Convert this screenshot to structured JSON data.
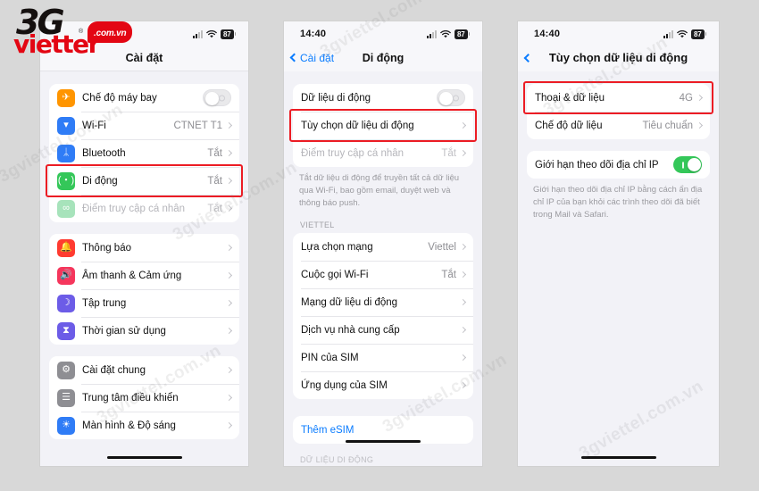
{
  "brand": {
    "logo_main": "3G",
    "logo_sub": "viettel",
    "logo_bubble": ".com.vn",
    "logo_tm": "®",
    "watermark": "3gviettel.com.vn",
    "accent_red": "#ec1c24",
    "brand_red": "#e30613",
    "ios_blue": "#0a7cff",
    "ios_green": "#34c759"
  },
  "status_bar": {
    "time_phone1": "",
    "time_phone2": "14:40",
    "time_phone3": "14:40",
    "battery": "87",
    "signal_icon": "cellular-signal-icon",
    "wifi_icon": "wifi-icon",
    "battery_icon": "battery-icon"
  },
  "phone1": {
    "nav": {
      "title": "Cài đặt",
      "back_label": ""
    },
    "groups": [
      {
        "rows": [
          {
            "icon": "airplane-icon",
            "icon_color": "#ff9500",
            "glyph": "✈",
            "label": "Chế độ máy bay",
            "value": "",
            "control": "toggle-off",
            "dim": false,
            "highlight": false
          },
          {
            "icon": "wifi-icon",
            "icon_color": "#2f7cf6",
            "glyph": "▾",
            "label": "Wi-Fi",
            "value": "CTNET T1",
            "control": "chevron",
            "dim": false,
            "highlight": false
          },
          {
            "icon": "bluetooth-icon",
            "icon_color": "#2f7cf6",
            "glyph": "ᛦ",
            "label": "Bluetooth",
            "value": "Tắt",
            "control": "chevron",
            "dim": false,
            "highlight": false
          },
          {
            "icon": "cellular-icon",
            "icon_color": "#34c759",
            "glyph": "(・)",
            "label": "Di động",
            "value": "Tắt",
            "control": "chevron",
            "dim": false,
            "highlight": true
          },
          {
            "icon": "hotspot-icon",
            "icon_color": "#a7e3bb",
            "glyph": "∞",
            "label": "Điểm truy cập cá nhân",
            "value": "Tắt",
            "control": "chevron",
            "dim": true,
            "highlight": false
          }
        ]
      },
      {
        "rows": [
          {
            "icon": "notifications-icon",
            "icon_color": "#ff3b30",
            "glyph": "🔔",
            "label": "Thông báo",
            "value": "",
            "control": "chevron",
            "dim": false,
            "highlight": false
          },
          {
            "icon": "sound-icon",
            "icon_color": "#f5365c",
            "glyph": "🔊",
            "label": "Âm thanh & Cảm ứng",
            "value": "",
            "control": "chevron",
            "dim": false,
            "highlight": false
          },
          {
            "icon": "focus-moon-icon",
            "icon_color": "#6c5ce7",
            "glyph": "☽",
            "label": "Tập trung",
            "value": "",
            "control": "chevron",
            "dim": false,
            "highlight": false
          },
          {
            "icon": "screen-time-icon",
            "icon_color": "#6c5ce7",
            "glyph": "⧗",
            "label": "Thời gian sử dụng",
            "value": "",
            "control": "chevron",
            "dim": false,
            "highlight": false
          }
        ]
      },
      {
        "rows": [
          {
            "icon": "general-gear-icon",
            "icon_color": "#8e8e93",
            "glyph": "⚙",
            "label": "Cài đặt chung",
            "value": "",
            "control": "chevron",
            "dim": false,
            "highlight": false
          },
          {
            "icon": "control-center-icon",
            "icon_color": "#8e8e93",
            "glyph": "☰",
            "label": "Trung tâm điều khiển",
            "value": "",
            "control": "chevron",
            "dim": false,
            "highlight": false
          },
          {
            "icon": "brightness-icon",
            "icon_color": "#2f7cf6",
            "glyph": "☀",
            "label": "Màn hình & Độ sáng",
            "value": "",
            "control": "chevron",
            "dim": false,
            "highlight": false
          }
        ]
      }
    ]
  },
  "phone2": {
    "nav": {
      "back_label": "Cài đặt",
      "title": "Di động"
    },
    "group1": [
      {
        "label": "Dữ liệu di động",
        "value": "",
        "control": "toggle-off",
        "dim": false,
        "highlight": false
      },
      {
        "label": "Tùy chọn dữ liệu di động",
        "value": "",
        "control": "chevron",
        "dim": false,
        "highlight": true
      },
      {
        "label": "Điểm truy cập cá nhân",
        "value": "Tắt",
        "control": "chevron",
        "dim": true,
        "highlight": false
      }
    ],
    "footnote1": "Tắt dữ liệu di động để truyền tất cả dữ liệu qua Wi-Fi, bao gồm email, duyệt web và thông báo push.",
    "section_header": "VIETTEL",
    "group2": [
      {
        "label": "Lựa chọn mạng",
        "value": "Viettel",
        "control": "chevron",
        "dim": false,
        "highlight": false
      },
      {
        "label": "Cuộc gọi Wi-Fi",
        "value": "Tắt",
        "control": "chevron",
        "dim": false,
        "highlight": false
      },
      {
        "label": "Mạng dữ liệu di động",
        "value": "",
        "control": "chevron",
        "dim": false,
        "highlight": false
      },
      {
        "label": "Dịch vụ nhà cung cấp",
        "value": "",
        "control": "chevron",
        "dim": false,
        "highlight": false
      },
      {
        "label": "PIN của SIM",
        "value": "",
        "control": "chevron",
        "dim": false,
        "highlight": false
      },
      {
        "label": "Ứng dụng của SIM",
        "value": "",
        "control": "chevron",
        "dim": false,
        "highlight": false
      }
    ],
    "group3": [
      {
        "label": "Thêm eSIM",
        "value": "",
        "control": "none",
        "dim": false,
        "highlight": false
      }
    ],
    "section_header2": "DỮ LIỆU DI ĐỘNG"
  },
  "phone3": {
    "nav": {
      "back_label": "",
      "title": "Tùy chọn dữ liệu di động"
    },
    "group1": [
      {
        "label": "Thoại & dữ liệu",
        "value": "4G",
        "control": "chevron",
        "dim": false,
        "highlight": true
      },
      {
        "label": "Chế độ dữ liệu",
        "value": "Tiêu chuẩn",
        "control": "chevron",
        "dim": false,
        "highlight": false
      }
    ],
    "group2": [
      {
        "label": "Giới hạn theo dõi địa chỉ IP",
        "value": "",
        "control": "toggle-on",
        "dim": false,
        "highlight": false
      }
    ],
    "footnote": "Giới hạn theo dõi địa chỉ IP bằng cách ẩn địa chỉ IP của bạn khỏi các trình theo dõi đã biết trong Mail và Safari."
  }
}
